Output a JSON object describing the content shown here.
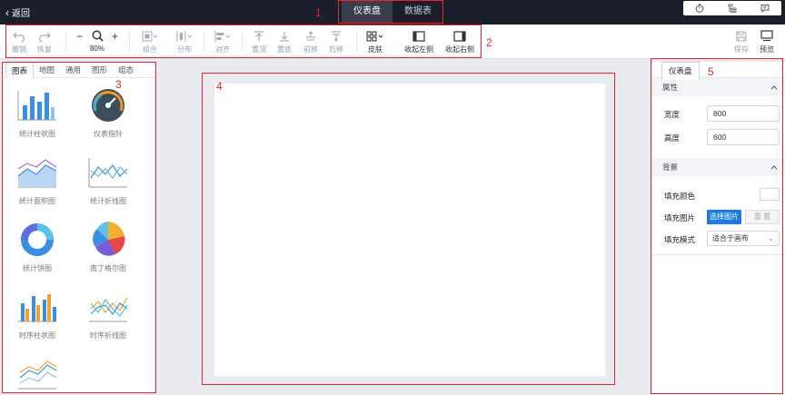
{
  "header": {
    "back_label": "返回",
    "tabs": [
      {
        "label": "仪表盘"
      },
      {
        "label": "数据表"
      }
    ],
    "active_tab": "仪表盘"
  },
  "annotations": [
    "1",
    "2",
    "3",
    "4",
    "5"
  ],
  "toolbar": {
    "undo": "撤销",
    "redo": "恢复",
    "zoom": "80%",
    "group": "组合",
    "distribute": "分布",
    "align": "对齐",
    "top": "置顶",
    "bottom": "置底",
    "forward": "前移",
    "backward": "后移",
    "skin": "皮肤",
    "collapse_left": "收起左侧",
    "collapse_right": "收起右侧",
    "save": "保存",
    "preview": "预览"
  },
  "left_panel": {
    "tabs": [
      "图表",
      "地图",
      "通用",
      "图形",
      "组态"
    ],
    "widgets": [
      {
        "label": "统计柱状图",
        "icon": "bar-chart-icon"
      },
      {
        "label": "仪表指针",
        "icon": "gauge-icon"
      },
      {
        "label": "统计面积图",
        "icon": "area-chart-icon"
      },
      {
        "label": "统计折线图",
        "icon": "line-chart-icon"
      },
      {
        "label": "统计饼图",
        "icon": "donut-chart-icon"
      },
      {
        "label": "南丁格尔图",
        "icon": "rose-chart-icon"
      },
      {
        "label": "时序柱状图",
        "icon": "time-bar-chart-icon"
      },
      {
        "label": "时序折线图",
        "icon": "time-line-chart-icon"
      },
      {
        "label": "",
        "icon": "line-chart-icon"
      }
    ]
  },
  "right_panel": {
    "tab": "仪表盘",
    "properties_title": "属性",
    "width_label": "宽度",
    "width_value": "800",
    "height_label": "高度",
    "height_value": "600",
    "background_title": "背景",
    "fill_color_label": "填充颜色",
    "fill_image_label": "填充图片",
    "select_image": "选择图片",
    "reset": "重 置",
    "fill_mode_label": "填充模式",
    "fill_mode_value": "适合于画布"
  },
  "colors": {
    "accent": "#1c7ce0",
    "topbar": "#1b1f2b",
    "annotation": "#e8252e"
  }
}
